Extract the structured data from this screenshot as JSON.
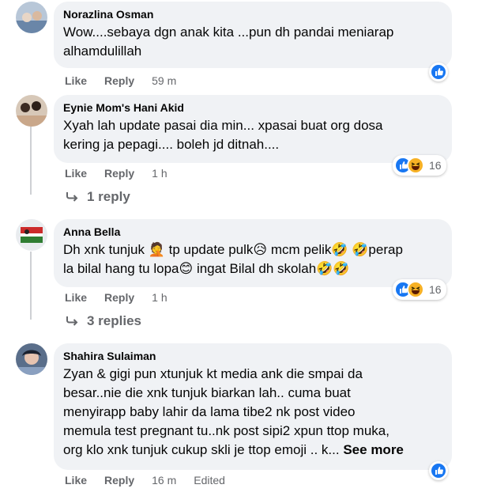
{
  "comments": [
    {
      "author": "Norazlina Osman",
      "lines": [
        "Wow....sebaya dgn anak kita ...pun dh pandai meniarap",
        "alhamdulillah"
      ],
      "like_label": "Like",
      "reply_label": "Reply",
      "time": "59 m",
      "reactions": []
    },
    {
      "author": "Eynie Mom's Hani Akid",
      "lines": [
        "Xyah lah update pasai dia min... xpasai buat org dosa",
        "kering ja pepagi.... boleh jd ditnah...."
      ],
      "like_label": "Like",
      "reply_label": "Reply",
      "time": "1 h",
      "reaction_count": "16",
      "reactions": [
        "like-icon",
        "haha-icon"
      ],
      "replies_label": "1 reply"
    },
    {
      "author": "Anna Bella",
      "lines": [
        "Dh xnk tunjuk 🤦 tp update pulk😥 mcm pelik🤣 🤣perap",
        "la bilal hang tu lopa😊 ingat Bilal dh skolah🤣🤣"
      ],
      "like_label": "Like",
      "reply_label": "Reply",
      "time": "1 h",
      "reaction_count": "16",
      "reactions": [
        "like-icon",
        "haha-icon"
      ],
      "replies_label": "3 replies"
    },
    {
      "author": "Shahira Sulaiman",
      "lines": [
        "Zyan & gigi pun xtunjuk kt media ank die smpai da",
        "besar..nie die xnk tunjuk biarkan lah.. cuma buat",
        "menyirapp baby lahir da lama tibe2 nk post video",
        "memula test pregnant tu..nk post sipi2 xpun ttop muka,",
        "org klo xnk tunjuk cukup skli je ttop emoji .. k..."
      ],
      "see_more": "See more",
      "like_label": "Like",
      "reply_label": "Reply",
      "time": "16 m",
      "edited": "Edited",
      "reactions": [
        "like-icon"
      ]
    }
  ],
  "colors": {
    "bubble": "#f0f2f5",
    "meta": "#65676b",
    "like_blue": "#1877f2",
    "haha_yellow": "#f7b125"
  }
}
